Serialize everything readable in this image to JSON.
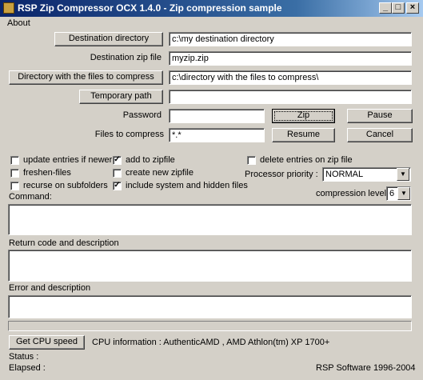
{
  "window": {
    "title": "RSP Zip Compressor OCX 1.4.0 - Zip compression sample"
  },
  "menu": {
    "about": "About"
  },
  "buttons": {
    "destination_directory": "Destination directory",
    "directory_files": "Directory with the files to compress",
    "temporary_path": "Temporary path",
    "zip": "Zip",
    "pause": "Pause",
    "resume": "Resume",
    "cancel": "Cancel",
    "get_cpu_speed": "Get CPU speed"
  },
  "labels": {
    "destination_zip_file": "Destination zip file",
    "password": "Password",
    "files_to_compress": "Files to compress",
    "processor_priority": "Processor priority :",
    "compression_level": "compression level",
    "command": "Command:",
    "return_code": "Return code and description",
    "error": "Error and description",
    "cpu_info": "CPU information : AuthenticAMD ,  AMD Athlon(tm) XP 1700+",
    "status": "Status :",
    "elapsed": "Elapsed :",
    "copyright": "RSP Software 1996-2004"
  },
  "fields": {
    "destination_directory": "c:\\my destination directory",
    "destination_zip_file": "myzip.zip",
    "directory_files": "c:\\directory with the files to compress\\",
    "temporary_path": "",
    "password": "",
    "files_to_compress": "*.*"
  },
  "options": {
    "update_entries": {
      "label": "update entries if newer",
      "checked": false
    },
    "freshen_files": {
      "label": "freshen-files",
      "checked": false
    },
    "recurse": {
      "label": "recurse on subfolders",
      "checked": false
    },
    "add_to_zipfile": {
      "label": "add to zipfile",
      "checked": true
    },
    "create_new": {
      "label": "create new zipfile",
      "checked": false
    },
    "include_system": {
      "label": "include system and hidden files",
      "checked": true
    },
    "delete_entries": {
      "label": "delete entries on zip file",
      "checked": false
    }
  },
  "selects": {
    "processor_priority": "NORMAL",
    "compression_level": "6"
  }
}
